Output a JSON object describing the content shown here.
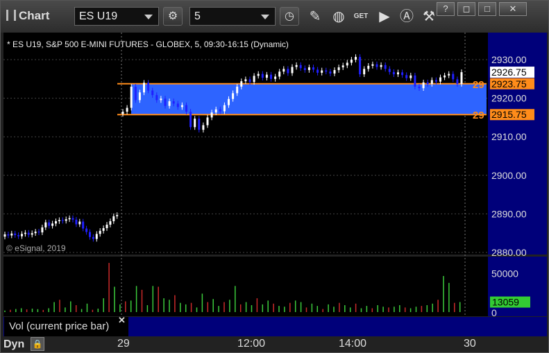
{
  "window": {
    "title": "Chart",
    "symbol": "ES U19",
    "interval": "5",
    "buttons": [
      "?",
      "◻",
      "□",
      "✕"
    ]
  },
  "chart_info": "* ES U19, S&P 500 E-MINI FUTURES - GLOBEX, 5, 09:30-16:15 (Dynamic)",
  "copyright": "© eSignal, 2019",
  "volume_label": "Vol (current price bar)",
  "dyn_label": "Dyn",
  "x_ticks": [
    "29",
    "12:00",
    "14:00",
    "30"
  ],
  "colors": {
    "up": "#ffffff",
    "down": "#2020ff",
    "band_fill": "#2e64ff",
    "band_line": "#ff8c1a",
    "axis_bg": "#00007a",
    "vol_up": "#3ccc3c",
    "vol_down": "#cc2a2a",
    "last_vol_bg": "#33cc33"
  },
  "chart_data": {
    "type": "candlestick",
    "price_axis": {
      "ylim": [
        2878,
        2934
      ],
      "ticks": [
        "2930.00",
        "2920.00",
        "2910.00",
        "2900.00",
        "2890.00",
        "2880.00"
      ]
    },
    "price_labels": {
      "last": "2926.75",
      "band_high": "2923.75",
      "band_low": "2915.75"
    },
    "band": {
      "high": 2923.75,
      "low": 2915.75,
      "label": "29"
    },
    "volume_axis": {
      "ylim": [
        0,
        65000
      ],
      "ticks": [
        "50000",
        "0"
      ],
      "last": "13059"
    },
    "prev_day_closes": [
      2884.7,
      2884.4,
      2884.9,
      2884.5,
      2884.2,
      2884.8,
      2885.1,
      2884.6,
      2885.0,
      2885.4,
      2885.2,
      2886.5,
      2887.8,
      2886.9,
      2887.5,
      2888.1,
      2888.4,
      2888.2,
      2888.6,
      2888.9,
      2888.5,
      2887.3,
      2888.0,
      2886.2,
      2885.3,
      2884.0,
      2883.5,
      2884.8,
      2885.6,
      2886.3,
      2887.2,
      2888.1,
      2889.4,
      2889.7
    ],
    "day_closes": [
      2916.5,
      2917.5,
      2923.0,
      2919.5,
      2921.5,
      2924.0,
      2922.0,
      2920.8,
      2919.5,
      2919.9,
      2918.0,
      2919.2,
      2918.6,
      2917.7,
      2918.2,
      2916.5,
      2912.5,
      2914.7,
      2911.8,
      2913.0,
      2915.0,
      2916.3,
      2917.1,
      2916.6,
      2918.2,
      2919.8,
      2921.3,
      2923.0,
      2924.4,
      2924.9,
      2924.2,
      2925.8,
      2926.3,
      2925.3,
      2926.1,
      2925.0,
      2925.6,
      2926.9,
      2927.6,
      2926.5,
      2928.1,
      2928.6,
      2927.8,
      2927.3,
      2928.0,
      2927.4,
      2926.6,
      2927.2,
      2926.9,
      2926.4,
      2927.3,
      2928.0,
      2928.5,
      2929.2,
      2930.0,
      2930.7,
      2926.2,
      2927.6,
      2928.4,
      2928.8,
      2928.1,
      2928.6,
      2927.6,
      2926.8,
      2926.2,
      2926.7,
      2926.0,
      2925.2,
      2925.9,
      2923.0,
      2922.6,
      2924.1,
      2923.7,
      2924.7,
      2924.3,
      2925.4,
      2925.9,
      2926.3,
      2924.9,
      2923.7,
      2926.75
    ],
    "day_volumes": [
      2000,
      3000,
      4000,
      5000,
      3500,
      4500,
      3800,
      2800,
      5000,
      13000,
      16000,
      6000,
      14000,
      9000,
      4000,
      11000,
      3000,
      4500,
      18000,
      64000,
      33000,
      10000,
      14000,
      15000,
      34000,
      29000,
      9000,
      34000,
      33000,
      18000,
      16000,
      22000,
      12000,
      10000,
      12000,
      6000,
      24000,
      13000,
      17000,
      8000,
      13000,
      16000,
      34000,
      10000,
      13000,
      9000,
      18000,
      10000,
      15000,
      11000,
      8000,
      7000,
      12000,
      15000,
      13000,
      6000,
      11000,
      8000,
      4000,
      10000,
      7000,
      12000,
      9000,
      6000,
      11000,
      5000,
      8000,
      5000,
      9000,
      7000,
      6000,
      7000,
      9000,
      6000,
      5000,
      7000,
      8000,
      9000,
      11000,
      16000,
      47000,
      38000,
      12000,
      13059
    ]
  }
}
